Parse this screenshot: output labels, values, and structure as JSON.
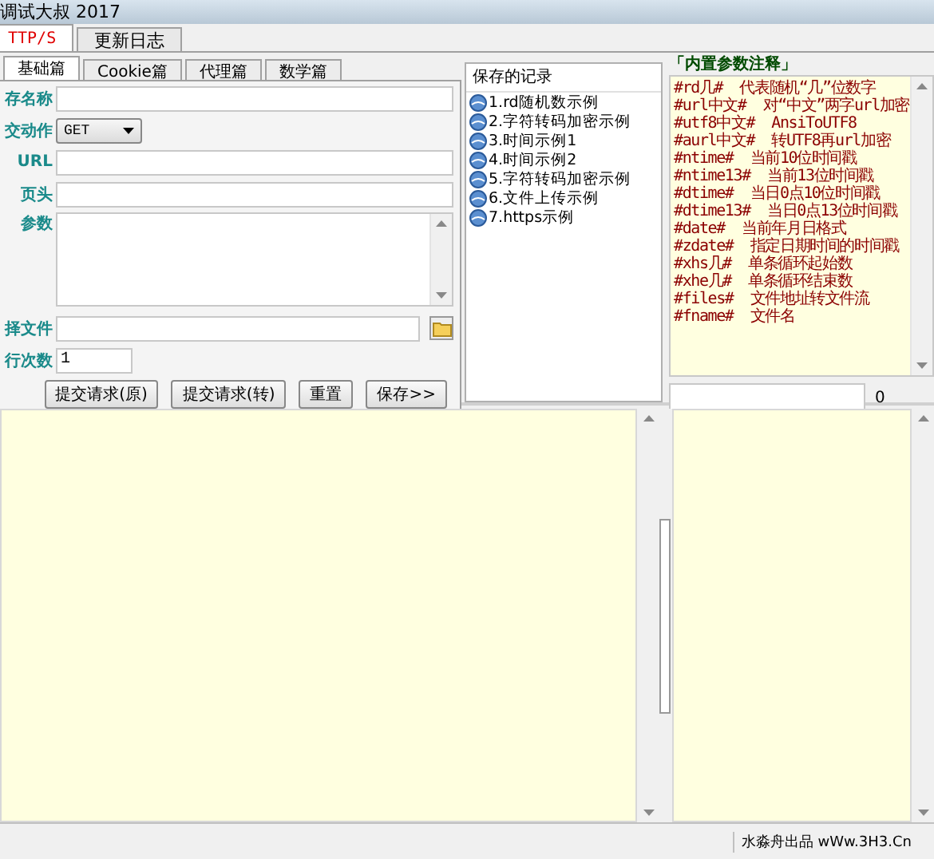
{
  "window": {
    "title": "调试大叔 2017"
  },
  "main_tabs": [
    {
      "label": "TTP/S",
      "selected": true
    },
    {
      "label": "更新日志",
      "selected": false
    }
  ],
  "sub_tabs": [
    {
      "label": "基础篇",
      "selected": true
    },
    {
      "label": "Cookie篇",
      "selected": false
    },
    {
      "label": "代理篇",
      "selected": false
    },
    {
      "label": "数学篇",
      "selected": false
    }
  ],
  "form": {
    "fields": [
      {
        "kind": "text",
        "label": "存名称"
      },
      {
        "kind": "select",
        "label": "交动作",
        "value": "GET"
      },
      {
        "kind": "text",
        "label": "URL"
      },
      {
        "kind": "text",
        "label": "页头"
      },
      {
        "kind": "textarea",
        "label": "参数"
      },
      {
        "kind": "file",
        "label": "择文件"
      },
      {
        "kind": "short",
        "label": "行次数",
        "value": "1"
      }
    ],
    "buttons": [
      "提交请求(原)",
      "提交请求(转)",
      "重置",
      "保存>>"
    ]
  },
  "records": {
    "title": "保存的记录",
    "items": [
      "1.rd随机数示例",
      "2.字符转码加密示例",
      "3.时间示例1",
      "4.时间示例2",
      "5.字符转码加密示例",
      "6.文件上传示例",
      "7.https示例"
    ]
  },
  "notes": {
    "title": "「内置参数注释」",
    "lines": [
      {
        "code": "#rd几#",
        "text": "代表随机“几”位数字"
      },
      {
        "code": "#url中文#",
        "text": "对“中文”两字url加密"
      },
      {
        "code": "#utf8中文#",
        "text": "AnsiToUTF8"
      },
      {
        "code": "#aurl中文#",
        "text": "转UTF8再url加密"
      },
      {
        "code": "#ntime#",
        "text": "当前10位时间戳"
      },
      {
        "code": "#ntime13#",
        "text": "当前13位时间戳"
      },
      {
        "code": "#dtime#",
        "text": "当日0点10位时间戳"
      },
      {
        "code": "#dtime13#",
        "text": "当日0点13位时间戳"
      },
      {
        "code": "#date#",
        "text": "当前年月日格式"
      },
      {
        "code": "#zdate#",
        "text": "指定日期时间的时间戳"
      },
      {
        "code": "#xhs几#",
        "text": "单条循环起始数"
      },
      {
        "code": "#xhe几#",
        "text": "单条循环结束数"
      },
      {
        "code": "#files#",
        "text": "文件地址转文件流"
      },
      {
        "code": "#fname#",
        "text": "文件名"
      }
    ],
    "count": "0"
  },
  "status_bar": {
    "credit": "水淼舟出品 wWw.3H3.Cn"
  }
}
